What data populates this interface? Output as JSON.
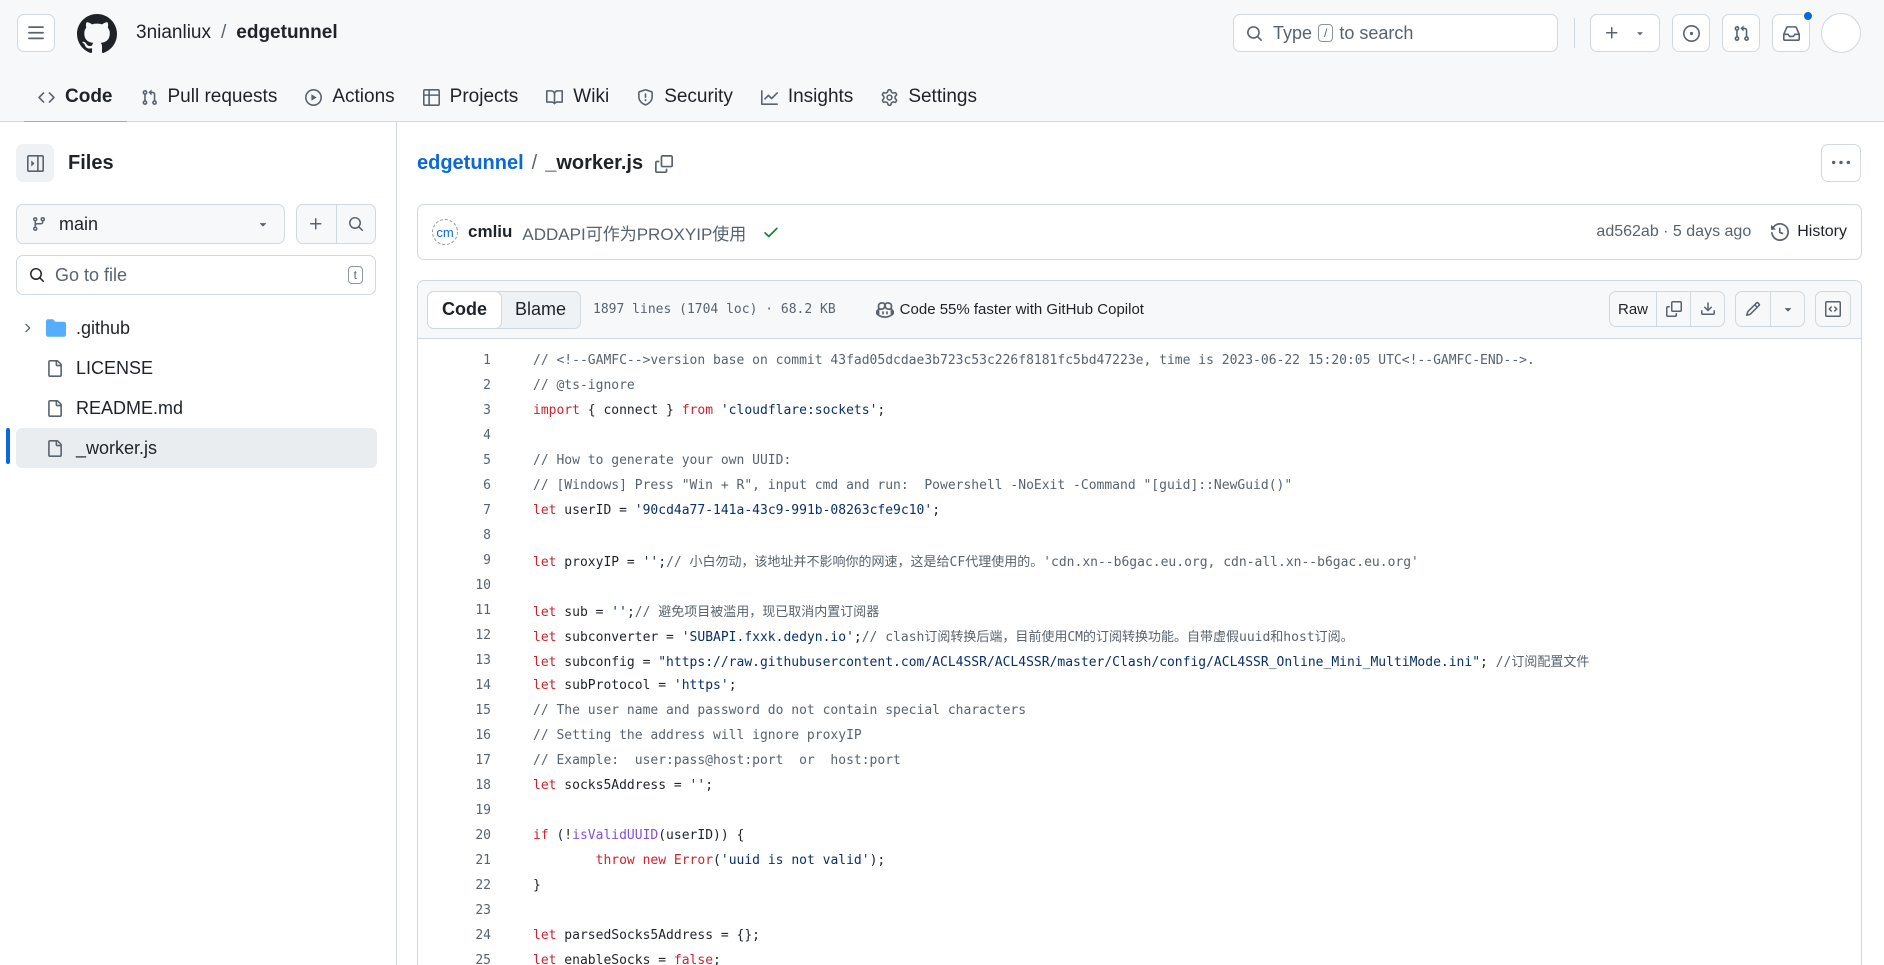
{
  "header": {
    "owner": "3nianliux",
    "separator": "/",
    "repo": "edgetunnel",
    "search": {
      "prefix": "Type",
      "key": "/",
      "suffix": "to search"
    }
  },
  "nav": {
    "tabs": [
      {
        "label": "Code",
        "icon": "code-icon",
        "active": true
      },
      {
        "label": "Pull requests",
        "icon": "pull-request-icon"
      },
      {
        "label": "Actions",
        "icon": "play-icon"
      },
      {
        "label": "Projects",
        "icon": "table-icon"
      },
      {
        "label": "Wiki",
        "icon": "book-icon"
      },
      {
        "label": "Security",
        "icon": "shield-icon"
      },
      {
        "label": "Insights",
        "icon": "graph-icon"
      },
      {
        "label": "Settings",
        "icon": "gear-icon"
      }
    ]
  },
  "sidebar": {
    "title": "Files",
    "branch": "main",
    "goto_placeholder": "Go to file",
    "goto_key": "t",
    "tree": [
      {
        "name": ".github",
        "type": "folder"
      },
      {
        "name": "LICENSE",
        "type": "file"
      },
      {
        "name": "README.md",
        "type": "file"
      },
      {
        "name": "_worker.js",
        "type": "file",
        "selected": true
      }
    ]
  },
  "main": {
    "path_repo": "edgetunnel",
    "path_sep": "/",
    "path_file": "_worker.js",
    "commit": {
      "avatar": "cm",
      "author": "cmliu",
      "message": "ADDAPI可作为PROXYIP使用",
      "meta": "ad562ab · 5 days ago",
      "history": "History"
    },
    "file": {
      "tab_code": "Code",
      "tab_blame": "Blame",
      "info": "1897 lines (1704 loc) · 68.2 KB",
      "copilot": "Code 55% faster with GitHub Copilot",
      "raw": "Raw"
    },
    "lines": [
      "// <!--GAMFC-->version base on commit 43fad05dcdae3b723c53c226f8181fc5bd47223e, time is 2023-06-22 15:20:05 UTC<!--GAMFC-END-->.",
      "// @ts-ignore",
      "import { connect } from 'cloudflare:sockets';",
      "",
      "// How to generate your own UUID:",
      "// [Windows] Press \"Win + R\", input cmd and run:  Powershell -NoExit -Command \"[guid]::NewGuid()\"",
      "let userID = '90cd4a77-141a-43c9-991b-08263cfe9c10';",
      "",
      "let proxyIP = '';// 小白勿动，该地址并不影响你的网速，这是给CF代理使用的。'cdn.xn--b6gac.eu.org, cdn-all.xn--b6gac.eu.org'",
      "",
      "let sub = '';// 避免项目被滥用，现已取消内置订阅器",
      "let subconverter = 'SUBAPI.fxxk.dedyn.io';// clash订阅转换后端，目前使用CM的订阅转换功能。自带虚假uuid和host订阅。",
      "let subconfig = \"https://raw.githubusercontent.com/ACL4SSR/ACL4SSR/master/Clash/config/ACL4SSR_Online_Mini_MultiMode.ini\"; //订阅配置文件",
      "let subProtocol = 'https';",
      "// The user name and password do not contain special characters",
      "// Setting the address will ignore proxyIP",
      "// Example:  user:pass@host:port  or  host:port",
      "let socks5Address = '';",
      "",
      "if (!isValidUUID(userID)) {",
      "        throw new Error('uuid is not valid');",
      "}",
      "",
      "let parsedSocks5Address = {};",
      "let enableSocks = false;"
    ]
  }
}
